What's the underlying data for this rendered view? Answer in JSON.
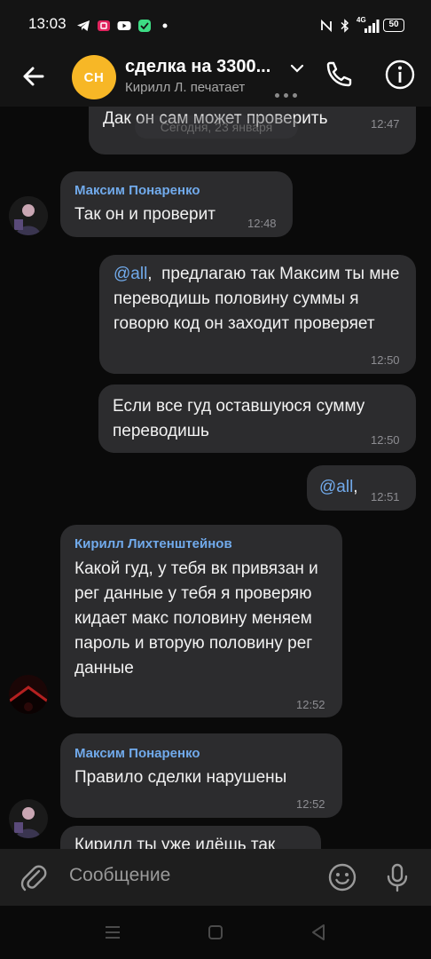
{
  "status_bar": {
    "time": "13:03",
    "icons_left": [
      "telegram-icon",
      "media-icon",
      "youtube-icon",
      "app-icon",
      "dot-icon"
    ],
    "icons_right": [
      "nfc-icon",
      "bluetooth-icon",
      "signal-4g-icon",
      "battery-icon"
    ],
    "network": "4G",
    "battery": "50"
  },
  "header": {
    "avatar_initials": "CH",
    "title": "сделка на 3300...",
    "subtitle": "Кирилл Л. печатает",
    "avatar_color": "#f7b726"
  },
  "chat": {
    "date_label": "Сегодня, 23 января",
    "messages": [
      {
        "text": "Дак он сам может проверить",
        "time": "12:47"
      },
      {
        "sender": "Максим Понаренко",
        "text": "Так он и проверит",
        "time": "12:48"
      },
      {
        "mention": "@all",
        "text": ",  предлагаю так Максим ты мне переводишь половину суммы я говорю код он заходит проверяет",
        "time": "12:50"
      },
      {
        "text": "Если все гуд оставшуюся сумму переводишь",
        "time": "12:50"
      },
      {
        "mention": "@all",
        "text": ",",
        "time": "12:51"
      },
      {
        "sender": "Кирилл Лихтенштейнов",
        "text": "Какой гуд, у тебя вк привязан и рег данные у тебя я проверяю кидает макс половину меняем пароль и вторую половину рег данные",
        "time": "12:52"
      },
      {
        "sender": "Максим Понаренко",
        "text": "Правило сделки нарушены",
        "time": "12:52"
      },
      {
        "text": "Кирилл ты уже идёшь так"
      }
    ]
  },
  "composer": {
    "placeholder": "Сообщение"
  },
  "colors": {
    "background": "#0a0a0a",
    "bubble": "#2c2c2e",
    "sender_name": "#71aaeb",
    "bars": "#141414"
  }
}
